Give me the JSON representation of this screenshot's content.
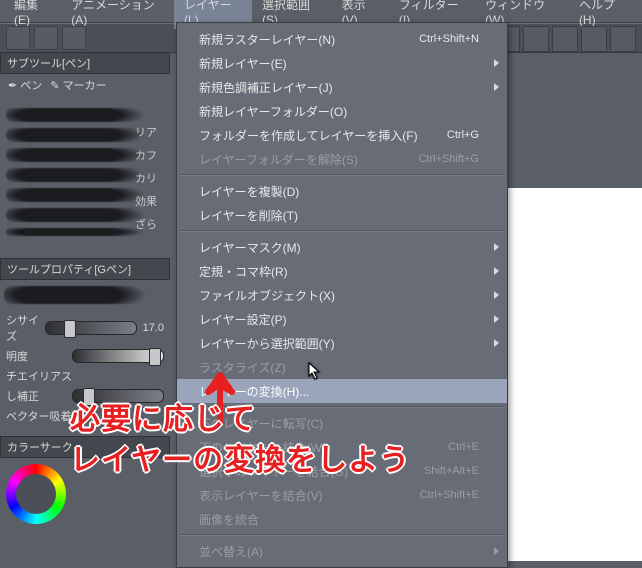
{
  "menubar": {
    "items": [
      {
        "label": "編集(E)"
      },
      {
        "label": "アニメーション(A)"
      },
      {
        "label": "レイヤー(L)",
        "open": true
      },
      {
        "label": "選択範囲(S)"
      },
      {
        "label": "表示(V)"
      },
      {
        "label": "フィルター(I)"
      },
      {
        "label": "ウィンドウ(W)"
      },
      {
        "label": "ヘルプ(H)"
      }
    ]
  },
  "subtool": {
    "title": "サブツール[ペン]",
    "tabs": [
      {
        "label": "ペン"
      },
      {
        "label": "マーカー"
      }
    ],
    "sideLabels": [
      "リア",
      "カフ",
      "カリ",
      "効果",
      "ざら"
    ]
  },
  "toolprop": {
    "title": "ツールプロパティ[Gペン]",
    "rows": [
      {
        "label": "シサイズ",
        "value": "17.0"
      },
      {
        "label": "明度",
        "value": ""
      },
      {
        "label": "チエイリアス",
        "value": ""
      },
      {
        "label": "し補正",
        "value": ""
      },
      {
        "label": "ベクター吸着",
        "value": ""
      }
    ]
  },
  "colorPanel": {
    "title": "カラーサーク"
  },
  "dropdown": {
    "items": [
      {
        "label": "新規ラスターレイヤー(N)",
        "shortcut": "Ctrl+Shift+N"
      },
      {
        "label": "新規レイヤー(E)",
        "submenu": true
      },
      {
        "label": "新規色調補正レイヤー(J)",
        "submenu": true
      },
      {
        "label": "新規レイヤーフォルダー(O)"
      },
      {
        "label": "フォルダーを作成してレイヤーを挿入(F)",
        "shortcut": "Ctrl+G"
      },
      {
        "label": "レイヤーフォルダーを解除(S)",
        "shortcut": "Ctrl+Shift+G",
        "disabled": true
      },
      {
        "sep": true
      },
      {
        "label": "レイヤーを複製(D)"
      },
      {
        "label": "レイヤーを削除(T)"
      },
      {
        "sep": true
      },
      {
        "label": "レイヤーマスク(M)",
        "submenu": true
      },
      {
        "label": "定規・コマ枠(R)",
        "submenu": true
      },
      {
        "label": "ファイルオブジェクト(X)",
        "submenu": true
      },
      {
        "label": "レイヤー設定(P)",
        "submenu": true
      },
      {
        "label": "レイヤーから選択範囲(Y)",
        "submenu": true
      },
      {
        "label": "ラスタライズ(Z)",
        "disabled": true
      },
      {
        "label": "レイヤーの変換(H)...",
        "hover": true
      },
      {
        "sep": true
      },
      {
        "label": "下のレイヤーに転写(C)",
        "disabled": true
      },
      {
        "label": "下のレイヤーと結合(W)",
        "shortcut": "Ctrl+E",
        "disabled": true
      },
      {
        "label": "選択中のレイヤーを結合(G)",
        "shortcut": "Shift+Alt+E",
        "disabled": true
      },
      {
        "label": "表示レイヤーを結合(V)",
        "shortcut": "Ctrl+Shift+E",
        "disabled": true
      },
      {
        "label": "画像を統合",
        "disabled": true
      },
      {
        "sep": true
      },
      {
        "label": "並べ替え(A)",
        "submenu": true,
        "disabled": true
      }
    ]
  },
  "annotation": {
    "line1": "必要に応じて",
    "line2": "レイヤーの変換をしよう"
  }
}
